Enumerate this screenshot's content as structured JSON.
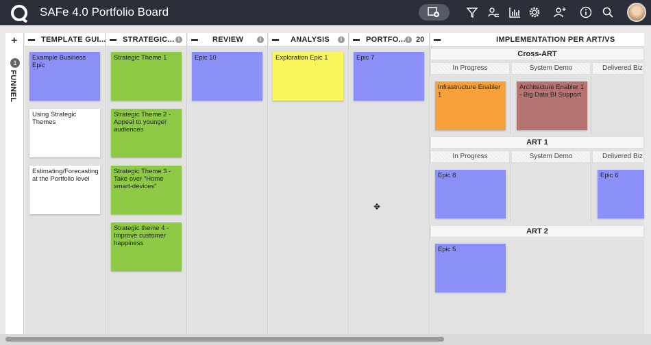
{
  "app": {
    "title": "SAFe 4.0 Portfolio Board"
  },
  "colors": {
    "topbar": "#2b2f3a",
    "purple": "#8b8ff8",
    "green": "#8ec945",
    "yellow": "#f9f75a",
    "orange": "#f7a13a",
    "brown": "#b57372"
  },
  "toolbar": {
    "icons": [
      "add-widget-icon",
      "filter-icon",
      "people-filter-icon",
      "chart-icon",
      "gear-icon",
      "add-user-icon",
      "info-icon",
      "search-icon"
    ]
  },
  "funnel": {
    "label": "FUNNEL",
    "count": "1"
  },
  "columns": [
    {
      "title": "TEMPLATE GUI...",
      "cards": [
        "Example Business Epic",
        "Using Strategic Themes",
        "Estimating/Forecasting at the Portfolio level"
      ]
    },
    {
      "title": "STRATEGIC...",
      "cards": [
        "Strategic Theme 1",
        "Strategic Theme 2 - Appeal to younger audiences",
        "Strategic Theme 3 - Take over \"Home smart-devices\"",
        "Strategic theme 4 - Improve customer happiness"
      ]
    },
    {
      "title": "REVIEW",
      "cards": [
        "Epic 10"
      ]
    },
    {
      "title": "ANALYSIS",
      "cards": [
        "Exploration Epic 1"
      ]
    },
    {
      "title": "PORTFO...",
      "count": "20",
      "cards": [
        "Epic 7"
      ]
    }
  ],
  "implementation": {
    "title": "IMPLEMENTATION PER ART/VS",
    "lanes": [
      {
        "name": "Cross-ART",
        "sub": [
          "In Progress",
          "System Demo",
          "Delivered Biz"
        ],
        "cards": [
          "Infrastructure Enabler 1",
          "Architecture Enabler 1 - Big Data BI Support"
        ]
      },
      {
        "name": "ART 1",
        "sub": [
          "In Progress",
          "System Demo",
          "Delivered Biz"
        ],
        "cards": [
          "Epic 8",
          "Epic 6"
        ]
      },
      {
        "name": "ART 2",
        "cards": [
          "Epic 5"
        ]
      }
    ]
  }
}
